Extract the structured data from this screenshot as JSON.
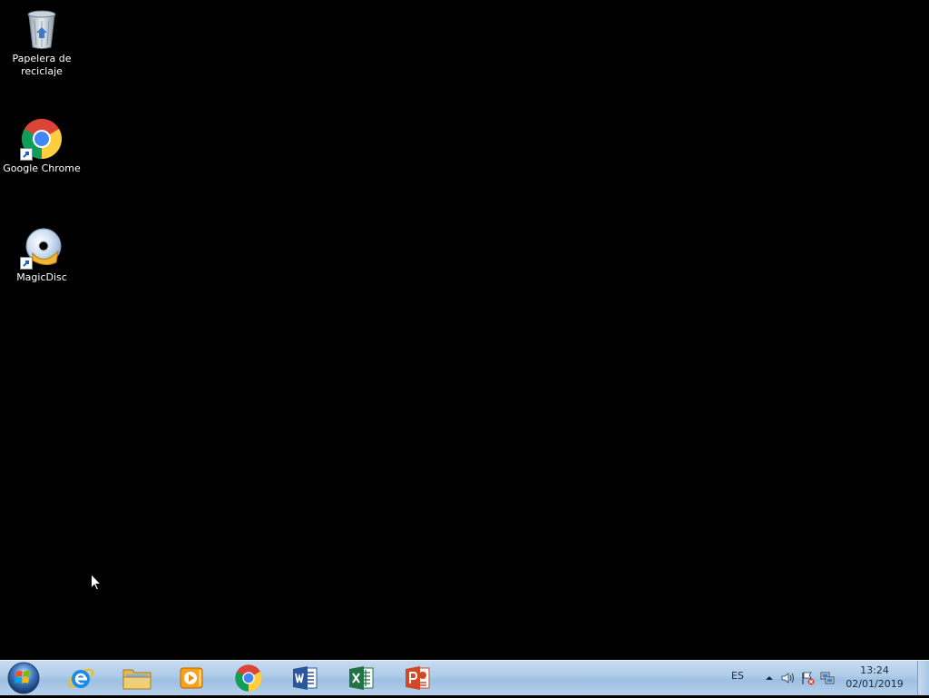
{
  "desktop": {
    "icons": [
      {
        "label": "Papelera de\nreciclaje",
        "icon": "recycle-bin-icon"
      },
      {
        "label": "Google Chrome",
        "icon": "chrome-icon"
      },
      {
        "label": "MagicDisc",
        "icon": "magicdisc-icon"
      }
    ]
  },
  "taskbar": {
    "start": {
      "icon": "windows-start-icon"
    },
    "pinned": [
      {
        "name": "Internet Explorer",
        "icon": "internet-explorer-icon"
      },
      {
        "name": "Explorador de Windows",
        "icon": "folder-icon"
      },
      {
        "name": "Windows Media Player",
        "icon": "media-player-icon"
      },
      {
        "name": "Google Chrome",
        "icon": "chrome-icon"
      },
      {
        "name": "Word",
        "icon": "word-icon"
      },
      {
        "name": "Excel",
        "icon": "excel-icon"
      },
      {
        "name": "PowerPoint",
        "icon": "powerpoint-icon"
      }
    ],
    "tray": {
      "language": "ES",
      "time": "13:24",
      "date": "02/01/2019"
    }
  },
  "colors": {
    "desktop_background": "#000000",
    "taskbar_top": "#c9dcf0",
    "taskbar_bottom": "#9dbfe2",
    "text_light": "#ffffff",
    "tray_text": "#1e2b3a"
  }
}
